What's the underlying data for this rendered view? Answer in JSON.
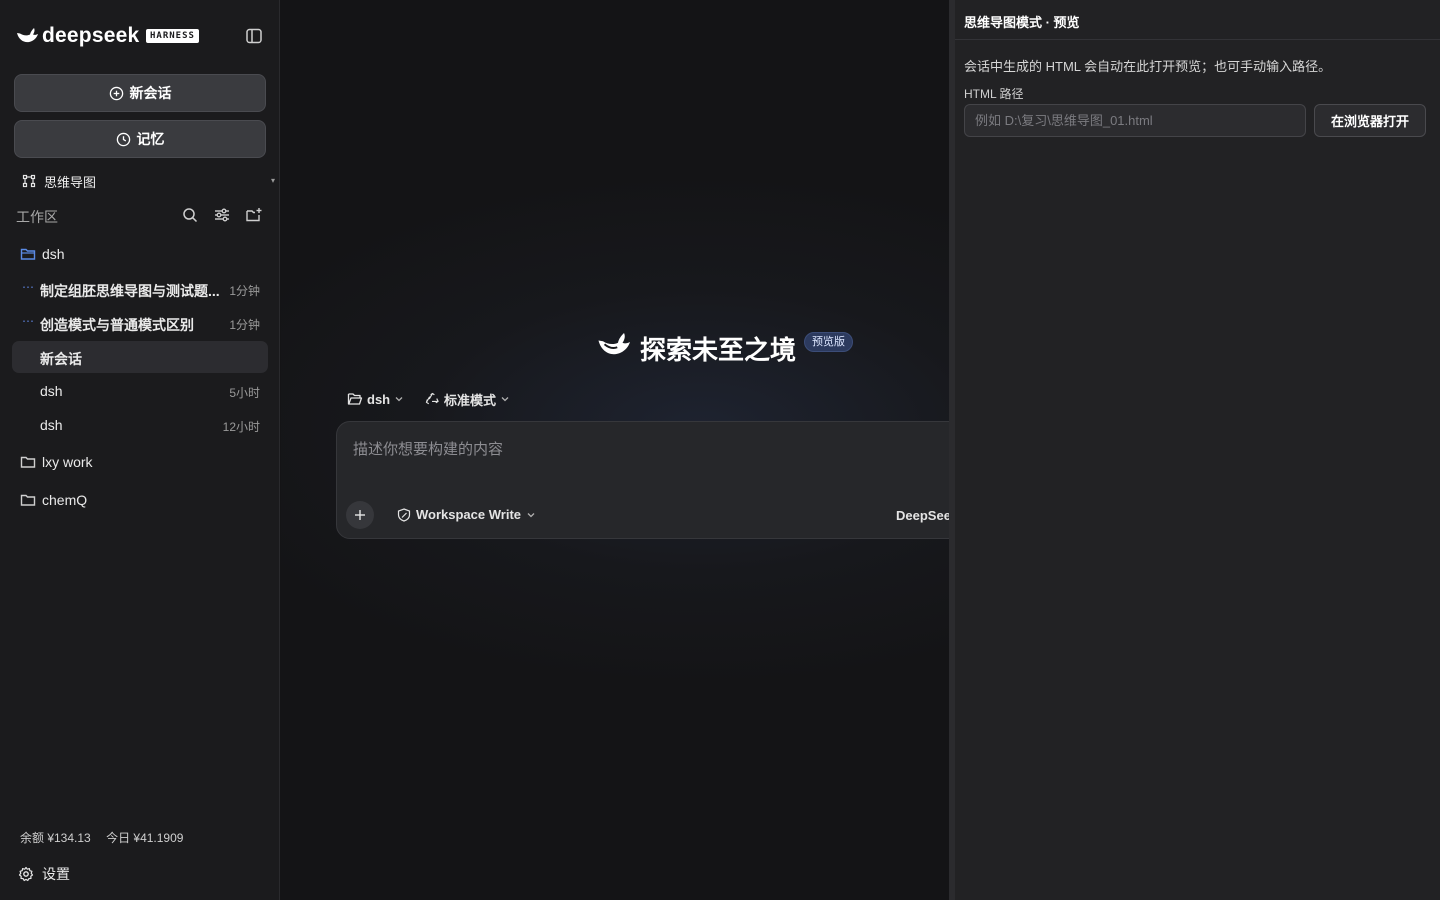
{
  "brand": {
    "name": "deepseek",
    "badge": "HARNESS"
  },
  "sidebar": {
    "new_chat_label": "新会话",
    "memory_label": "记忆",
    "mode_label": "思维导图",
    "workspace_title": "工作区",
    "tree": [
      {
        "type": "folder",
        "label": "dsh",
        "open": true
      },
      {
        "type": "chat",
        "label": "制定组胚思维导图与测试题...",
        "time": "1分钟",
        "running": true
      },
      {
        "type": "chat",
        "label": "创造模式与普通模式区别",
        "time": "1分钟",
        "running": true
      },
      {
        "type": "chat",
        "label": "新会话",
        "time": "",
        "active": true
      },
      {
        "type": "chat",
        "label": "dsh",
        "time": "5小时"
      },
      {
        "type": "chat",
        "label": "dsh",
        "time": "12小时"
      },
      {
        "type": "folder",
        "label": "lxy work",
        "open": false
      },
      {
        "type": "folder",
        "label": "chemQ",
        "open": false
      }
    ],
    "balance_label": "余额 ¥134.13",
    "today_label": "今日 ¥41.1909",
    "settings_label": "设置"
  },
  "main": {
    "hero_title": "探索未至之境",
    "hero_badge": "预览版",
    "workspace_chip": "dsh",
    "mode_chip": "标准模式",
    "composer_placeholder": "描述你想要构建的内容",
    "permission_chip": "Workspace Write",
    "model_chip": "DeepSeek"
  },
  "preview": {
    "title": "思维导图模式 · 预览",
    "description": "会话中生成的 HTML 会自动在此打开预览；也可手动输入路径。",
    "path_label": "HTML 路径",
    "path_placeholder": "例如 D:\\复习\\思维导图_01.html",
    "open_button": "在浏览器打开"
  },
  "colors": {
    "accent_blue": "#5b7fd6",
    "sidebar_bg": "#1b1b1d",
    "panel_bg": "#222224",
    "badge_bg": "#2c3a5e"
  }
}
